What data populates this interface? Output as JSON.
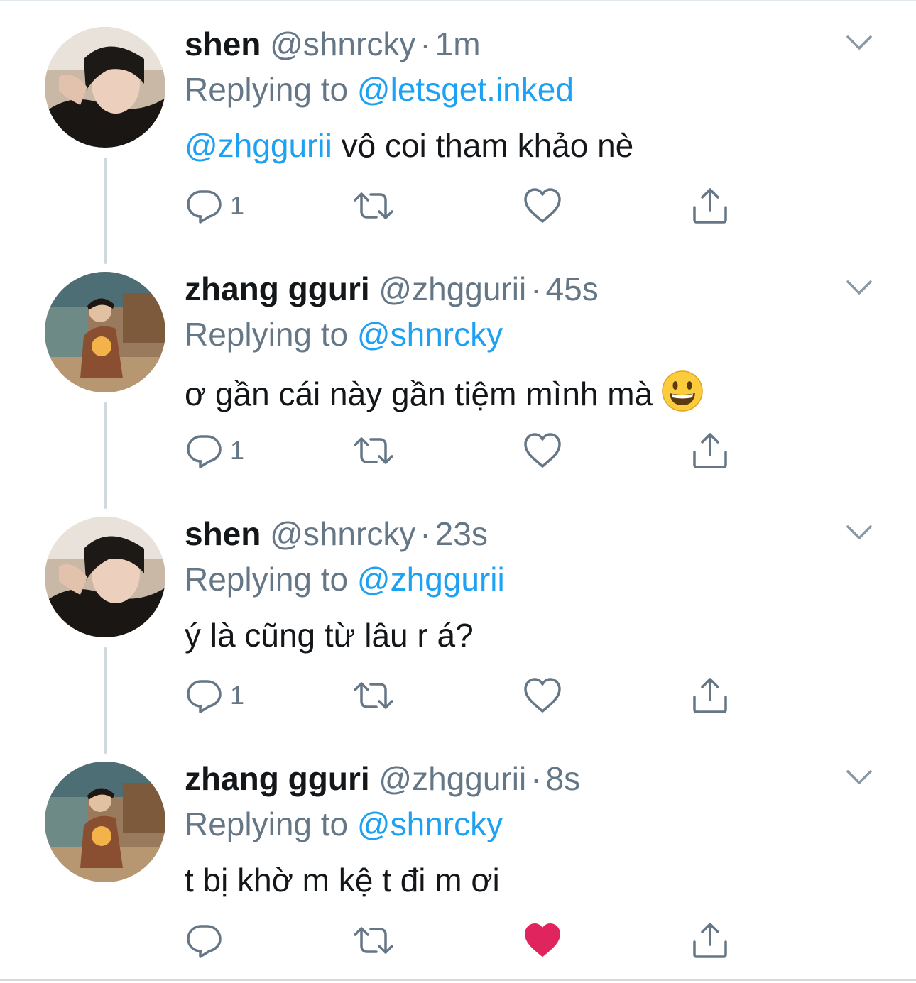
{
  "colors": {
    "link": "#1da1f2",
    "muted": "#657786",
    "text": "#14171a",
    "liked": "#e0245e",
    "thread_line": "#cfd9de"
  },
  "icons": {
    "reply": "reply-icon",
    "retweet": "retweet-icon",
    "like": "heart-icon",
    "share": "share-icon",
    "more": "chevron-down-icon"
  },
  "tweets": [
    {
      "name": "shen",
      "handle": "@shnrcky",
      "separator": "·",
      "time": "1m",
      "replying_prefix": "Replying to",
      "replying_to": "@letsget.inked",
      "mention": "@zhggurii",
      "text": " vô coi tham khảo nè",
      "reply_count": "1",
      "liked": false
    },
    {
      "name": "zhang gguri",
      "handle": "@zhggurii",
      "separator": "·",
      "time": "45s",
      "replying_prefix": "Replying to",
      "replying_to": "@shnrcky",
      "mention": "",
      "text": "ơ gần cái này gần tiệm mình mà",
      "emoji": "grinning-face-emoji",
      "reply_count": "1",
      "liked": false
    },
    {
      "name": "shen",
      "handle": "@shnrcky",
      "separator": "·",
      "time": "23s",
      "replying_prefix": "Replying to",
      "replying_to": "@zhggurii",
      "mention": "",
      "text": "ý là cũng từ lâu r á?",
      "reply_count": "1",
      "liked": false
    },
    {
      "name": "zhang gguri",
      "handle": "@zhggurii",
      "separator": "·",
      "time": "8s",
      "replying_prefix": "Replying to",
      "replying_to": "@shnrcky",
      "mention": "",
      "text": "t bị khờ m kệ t đi m ơi",
      "reply_count": "",
      "liked": true
    }
  ]
}
